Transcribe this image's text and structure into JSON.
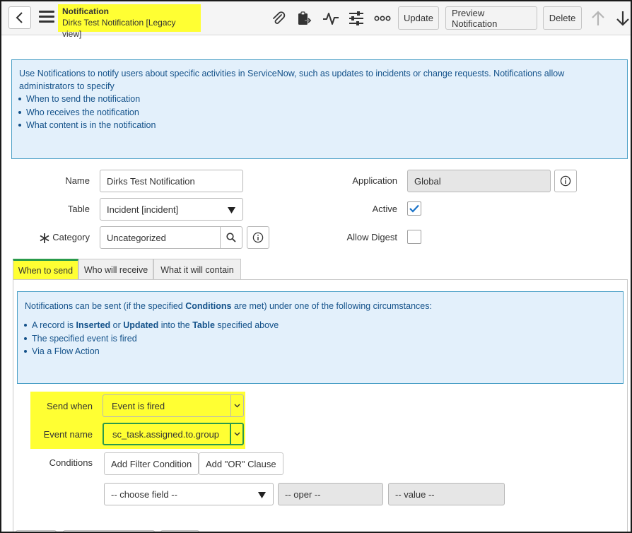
{
  "header": {
    "title": "Notification",
    "subtitle": "Dirks Test Notification [Legacy view]",
    "buttons": {
      "update": "Update",
      "preview": "Preview Notification",
      "delete": "Delete"
    },
    "icons": [
      "back-icon",
      "hamburger-menu-icon",
      "paperclip-icon",
      "clipboard-icon",
      "activity-icon",
      "settings-sliders-icon",
      "more-options-icon",
      "arrow-up-icon",
      "arrow-down-icon"
    ]
  },
  "intro": {
    "text": "Use Notifications to notify users about specific activities in ServiceNow, such as updates to incidents or change requests. Notifications allow administrators to specify",
    "items": [
      "When to send the notification",
      "Who receives the notification",
      "What content is in the notification"
    ]
  },
  "form": {
    "name_label": "Name",
    "name_value": "Dirks Test Notification",
    "table_label": "Table",
    "table_value": "Incident [incident]",
    "category_label": "Category",
    "category_value": "Uncategorized",
    "application_label": "Application",
    "application_value": "Global",
    "active_label": "Active",
    "active_checked": true,
    "allow_digest_label": "Allow Digest",
    "allow_digest_checked": false
  },
  "tabs": [
    "When to send",
    "Who will receive",
    "What it will contain"
  ],
  "when": {
    "info": {
      "pre": "Notifications can be sent (if the specified ",
      "bold": "Conditions",
      "post": " are met) under one of the following circumstances:",
      "item1": {
        "a": "A record is ",
        "b": "Inserted",
        "c": " or ",
        "d": "Updated",
        "e": " into the ",
        "f": "Table",
        "g": " specified above"
      },
      "item2": "The specified event is fired",
      "item3": "Via a Flow Action"
    },
    "send_when_label": "Send when",
    "send_when_value": "Event is fired",
    "event_name_label": "Event name",
    "event_name_value": "sc_task.assigned.to.group",
    "conditions_label": "Conditions",
    "add_filter": "Add Filter Condition",
    "add_or": "Add \"OR\" Clause",
    "choose_field": "-- choose field --",
    "oper": "-- oper --",
    "value": "-- value --"
  },
  "colors": {
    "highlight": "#ffff33",
    "info_bg": "#e3f0fb",
    "info_text": "#14528a",
    "active_tab_border": "#2a9a4b",
    "check": "#1a73c8"
  }
}
